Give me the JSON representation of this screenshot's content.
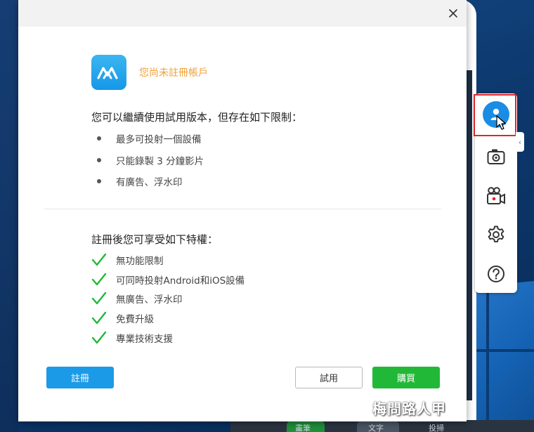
{
  "dialog": {
    "account_status": "您尚未註冊帳戶",
    "trial_heading": "您可以繼續使用試用版本，但存在如下限制：",
    "limitations": [
      "最多可投射一個設備",
      "只能錄製 3 分鐘影片",
      "有廣告、浮水印"
    ],
    "benefits_heading": "註冊後您可享受如下特權：",
    "benefits": [
      "無功能限制",
      "可同時投射Android和iOS設備",
      "無廣告、浮水印",
      "免費升級",
      "專業技術支援"
    ],
    "buttons": {
      "register": "註冊",
      "trial": "試用",
      "buy": "購買"
    }
  },
  "toolbar": {
    "items": [
      "account-icon",
      "screenshot-camera-icon",
      "record-video-icon",
      "settings-gear-icon",
      "help-icon"
    ]
  },
  "taskbar": {
    "labels": [
      "畫筆",
      "文字",
      "投掃"
    ]
  },
  "watermark": "梅問路人甲",
  "colors": {
    "accent_blue": "#1b9ae8",
    "buy_green": "#22b837",
    "status_orange": "#f0a23a",
    "highlight_red": "#e0262b"
  }
}
